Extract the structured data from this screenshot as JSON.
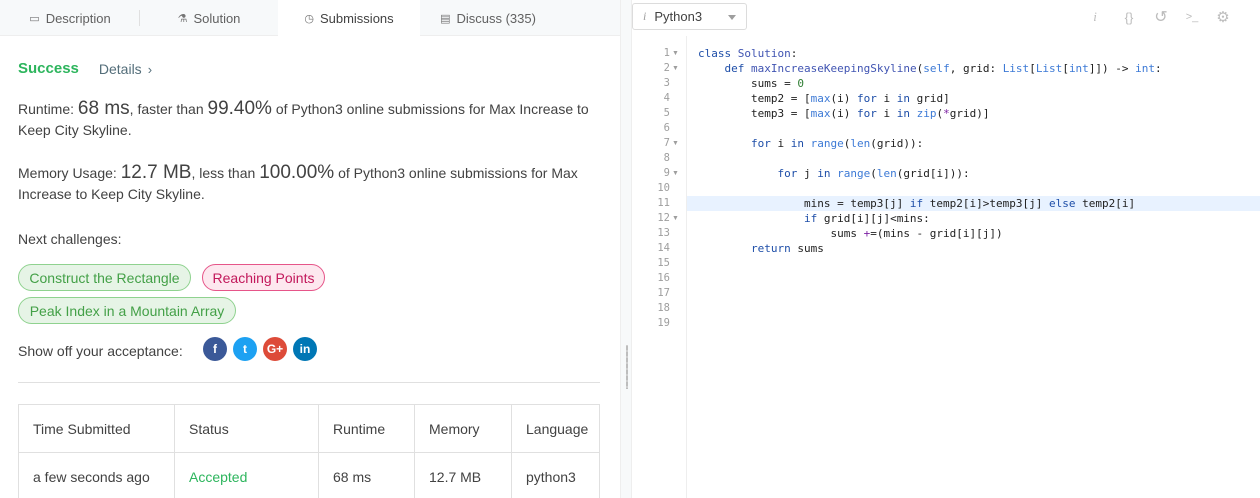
{
  "tabs": [
    {
      "label": "Description",
      "icon": "document-icon"
    },
    {
      "label": "Solution",
      "icon": "flask-icon"
    },
    {
      "label": "Submissions",
      "icon": "clock-icon"
    },
    {
      "label": "Discuss (335)",
      "icon": "chat-icon"
    }
  ],
  "result": {
    "status": "Success",
    "details": "Details",
    "runtime_prefix": "Runtime:",
    "runtime_value": "68 ms",
    "runtime_mid": ", faster than",
    "runtime_pct": "99.40%",
    "runtime_suffix": "of Python3 online submissions for Max Increase to Keep City Skyline.",
    "memory_prefix": "Memory Usage:",
    "memory_value": "12.7 MB",
    "memory_mid": ", less than",
    "memory_pct": "100.00%",
    "memory_suffix": "of Python3 online submissions for Max Increase to Keep City Skyline."
  },
  "next_challenges": {
    "label": "Next challenges:",
    "items": [
      {
        "title": "Construct the Rectangle",
        "difficulty": "easy"
      },
      {
        "title": "Reaching Points",
        "difficulty": "hard"
      },
      {
        "title": "Peak Index in a Mountain Array",
        "difficulty": "easy"
      }
    ]
  },
  "share": {
    "label": "Show off your acceptance:",
    "networks": [
      {
        "name": "facebook-icon",
        "glyph": "f",
        "color": "#3b5998"
      },
      {
        "name": "twitter-icon",
        "glyph": "t",
        "color": "#1da1f2"
      },
      {
        "name": "google-plus-icon",
        "glyph": "G+",
        "color": "#dd4b39"
      },
      {
        "name": "linkedin-icon",
        "glyph": "in",
        "color": "#0077b5"
      }
    ]
  },
  "submissions_table": {
    "headers": [
      "Time Submitted",
      "Status",
      "Runtime",
      "Memory",
      "Language"
    ],
    "rows": [
      [
        "a few seconds ago",
        "Accepted",
        "68 ms",
        "12.7 MB",
        "python3"
      ]
    ]
  },
  "editor": {
    "language": "Python3",
    "highlighted_line": 11,
    "line_numbers": [
      "1",
      "2",
      "3",
      "4",
      "5",
      "6",
      "7",
      "8",
      "9",
      "10",
      "11",
      "12",
      "13",
      "14",
      "15",
      "16",
      "17",
      "18",
      "19"
    ],
    "folded_lines": [
      1,
      2,
      7,
      9,
      12
    ],
    "lines": [
      "class Solution:",
      "    def maxIncreaseKeepingSkyline(self, grid: List[List[int]]) -> int:",
      "        sums = 0",
      "        temp2 = [max(i) for i in grid]",
      "        temp3 = [max(i) for i in zip(*grid)]",
      "",
      "        for i in range(len(grid)):",
      "",
      "            for j in range(len(grid[i])):",
      "",
      "                mins = temp3[j] if temp2[i]>temp3[j] else temp2[i]",
      "                if grid[i][j]<mins:",
      "                    sums +=(mins - grid[i][j])",
      "        return sums",
      "",
      "",
      "",
      "",
      ""
    ]
  },
  "toolbar": {
    "info_glyph": "i",
    "tools": [
      {
        "name": "info-icon",
        "glyph": "i"
      },
      {
        "name": "braces-icon",
        "glyph": "{}"
      },
      {
        "name": "reset-icon",
        "glyph": "↺"
      },
      {
        "name": "console-icon",
        "glyph": ">_"
      },
      {
        "name": "settings-icon",
        "glyph": "⚙"
      }
    ]
  }
}
